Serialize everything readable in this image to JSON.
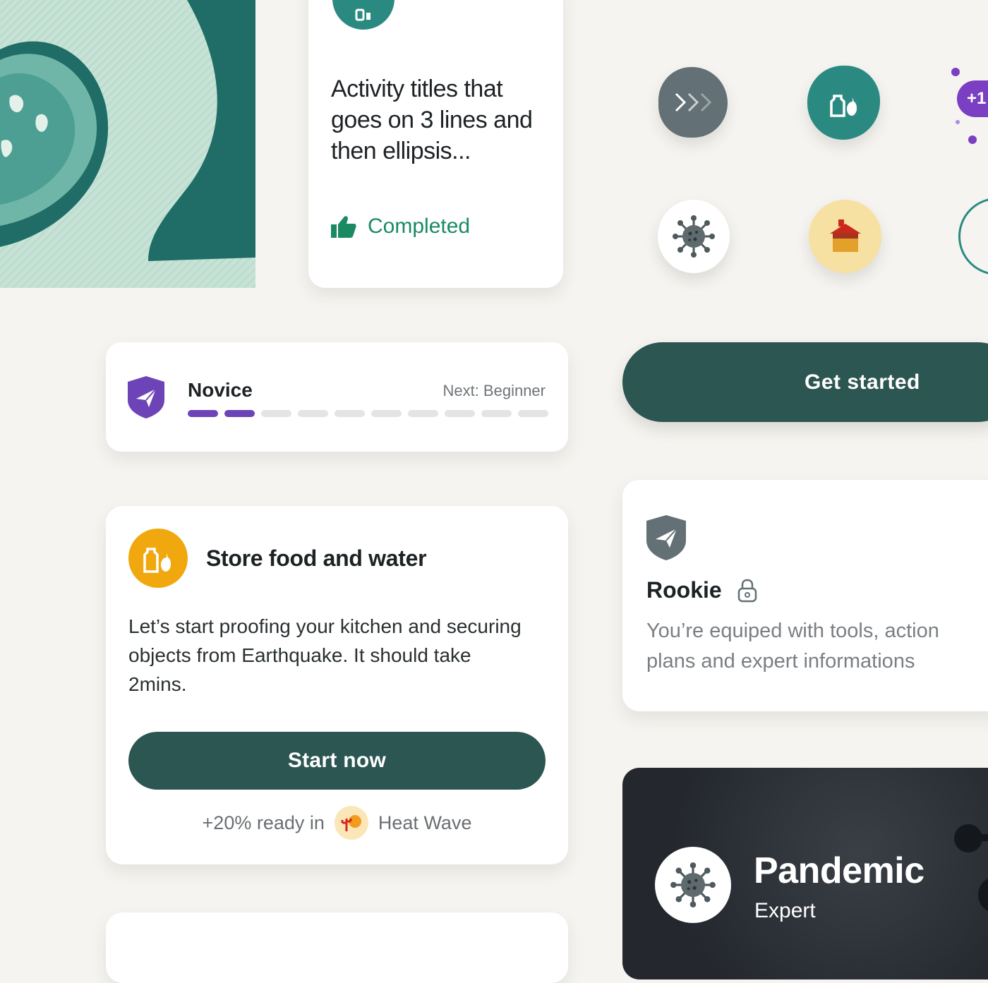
{
  "activity_card": {
    "title": "Activity titles that goes on 3 lines and then ellipsis...",
    "status": "Completed",
    "status_icon": "thumbs-up-icon"
  },
  "icons": [
    {
      "name": "forward-chevrons-icon",
      "bg": "#637075"
    },
    {
      "name": "food-water-icon",
      "bg": "#2a8a82"
    },
    {
      "name": "plus-badge-icon",
      "bg": "#7a3fc2",
      "label": "+1"
    },
    {
      "name": "virus-icon",
      "bg": "#ffffff"
    },
    {
      "name": "house-icon",
      "bg": "#f6e0a2"
    }
  ],
  "level_card": {
    "level": "Novice",
    "next": "Next: Beginner",
    "progress_filled": 2,
    "progress_total": 10
  },
  "get_started": {
    "label": "Get started"
  },
  "task_card": {
    "title": "Store food and water",
    "description": "Let’s start proofing your kitchen and securing objects from Earthquake. It should take 2mins.",
    "button": "Start now",
    "ready_text": "+20% ready in",
    "hazard": "Heat Wave"
  },
  "rookie_card": {
    "level": "Rookie",
    "description_line1": "You’re equiped with tools, action",
    "description_line2": "plans and expert informations"
  },
  "pandemic_card": {
    "title": "Pandemic",
    "subtitle": "Expert"
  },
  "colors": {
    "primary_dark": "#2c5651",
    "success": "#1a8a63",
    "purple": "#6d44b8",
    "amber": "#f0a80e"
  }
}
